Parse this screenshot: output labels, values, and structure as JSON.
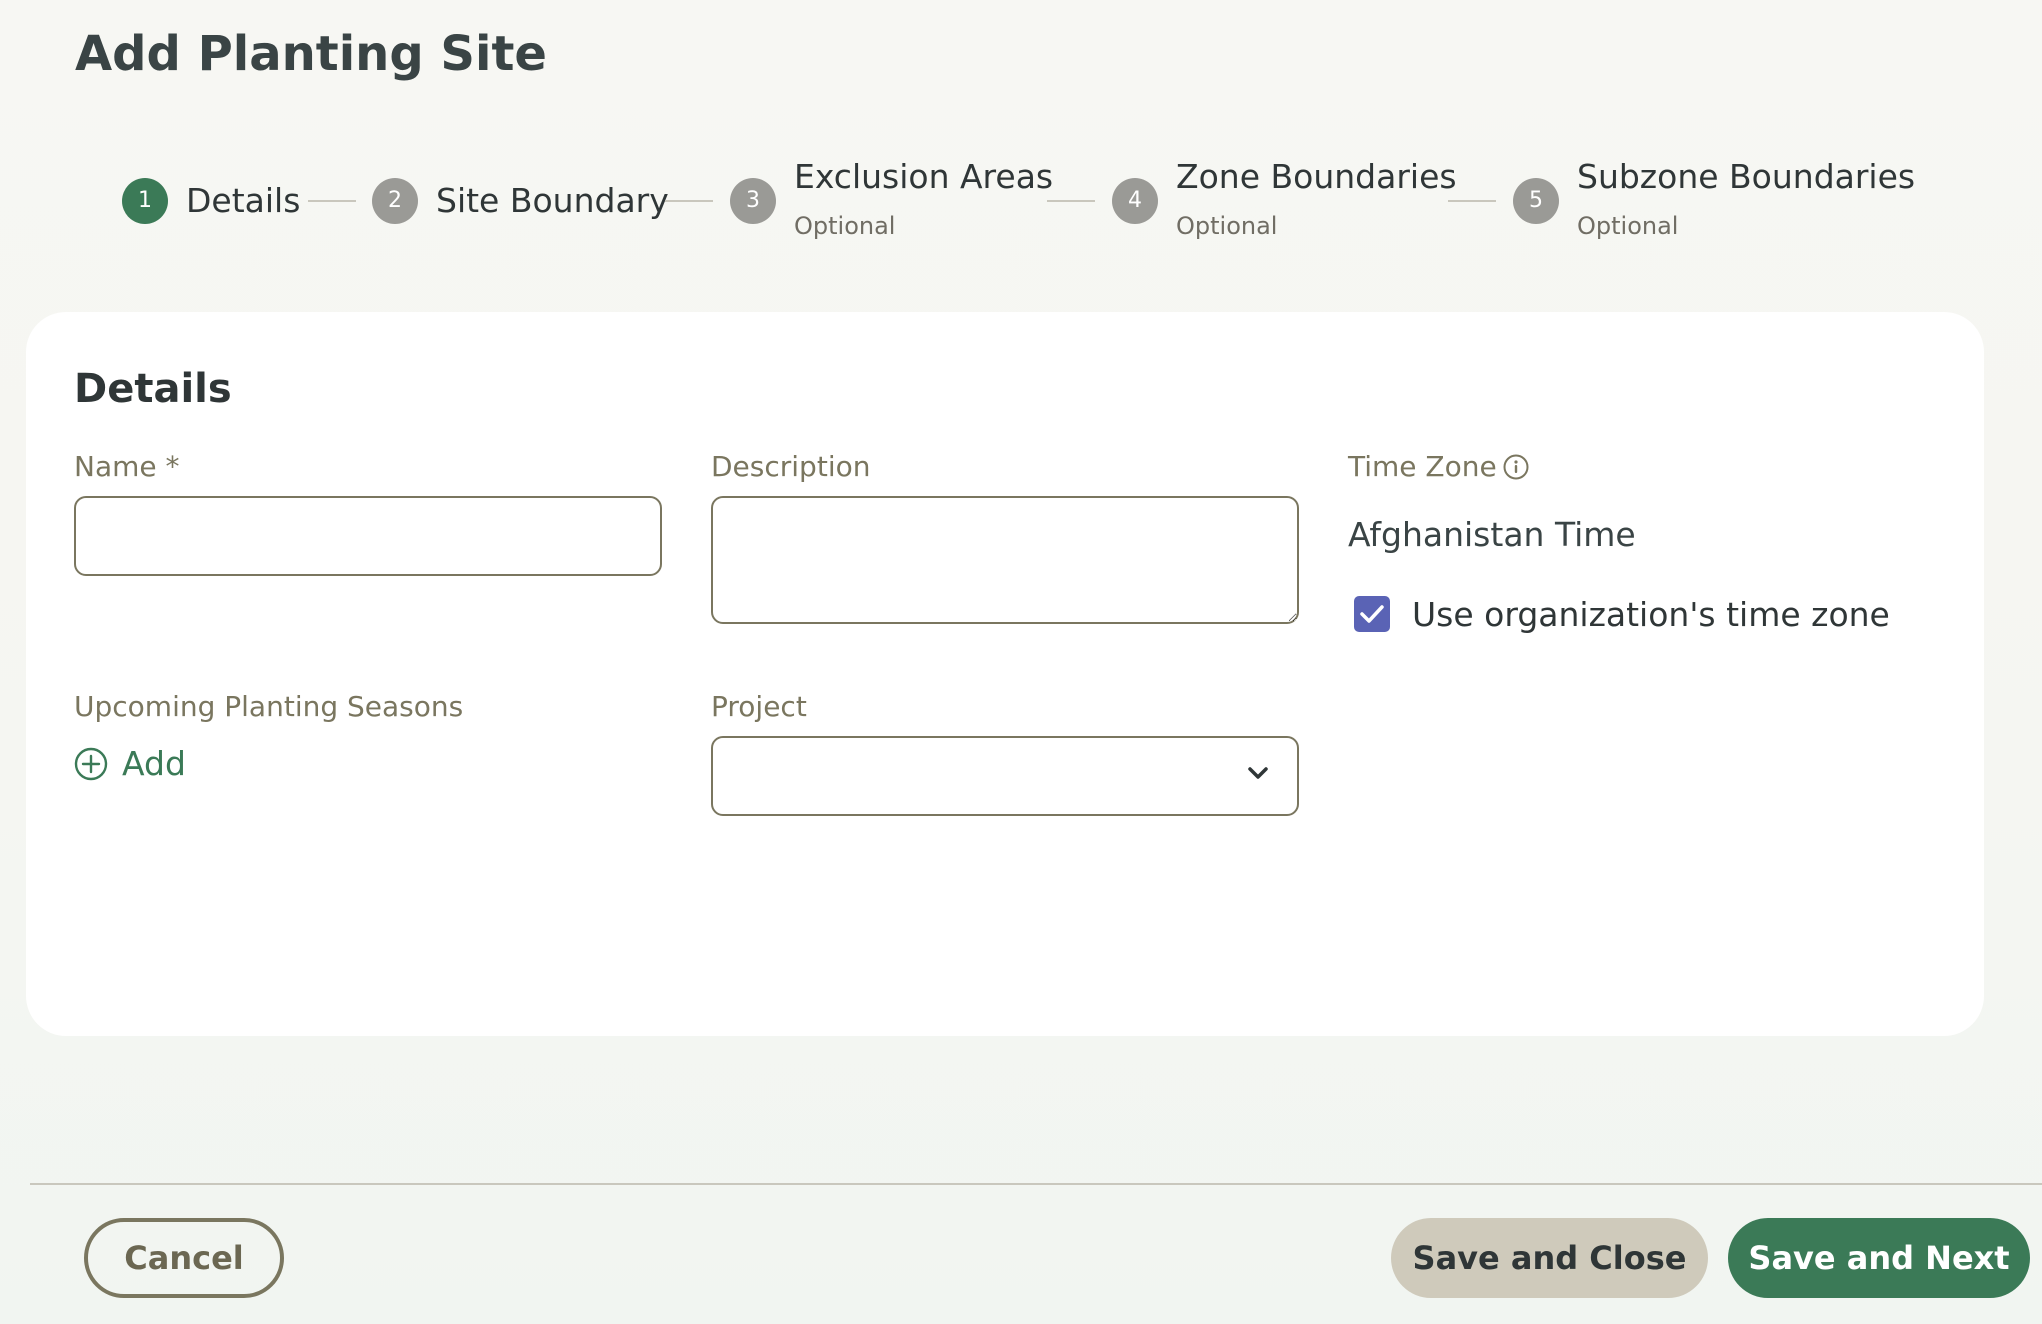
{
  "page": {
    "title": "Add Planting Site"
  },
  "stepper": {
    "steps": [
      {
        "number": "1",
        "label": "Details",
        "sub": ""
      },
      {
        "number": "2",
        "label": "Site Boundary",
        "sub": ""
      },
      {
        "number": "3",
        "label": "Exclusion Areas",
        "sub": "Optional"
      },
      {
        "number": "4",
        "label": "Zone Boundaries",
        "sub": "Optional"
      },
      {
        "number": "5",
        "label": "Subzone Boundaries",
        "sub": "Optional"
      }
    ],
    "active_step": 1,
    "colors": {
      "active": "#3b7a57",
      "inactive": "#9a9a96"
    }
  },
  "details": {
    "title": "Details",
    "name": {
      "label": "Name *",
      "value": "",
      "placeholder": ""
    },
    "description": {
      "label": "Description",
      "value": "",
      "placeholder": ""
    },
    "time_zone": {
      "label": "Time Zone",
      "icon": "info-icon",
      "value": "Afghanistan Time",
      "use_org_checkbox": {
        "label": "Use organization's time zone",
        "checked": true
      }
    },
    "planting_seasons": {
      "label": "Upcoming Planting Seasons",
      "add_label": "Add",
      "icon": "plus-circle-icon"
    },
    "project": {
      "label": "Project",
      "value": "",
      "icon": "chevron-down-icon"
    }
  },
  "footer": {
    "cancel_label": "Cancel",
    "save_close_label": "Save and Close",
    "save_next_label": "Save and Next"
  },
  "colors": {
    "primary": "#3b7a57",
    "checkbox": "#5a63b5",
    "secondary_button": "#cfcabb",
    "border": "#7a765f"
  }
}
